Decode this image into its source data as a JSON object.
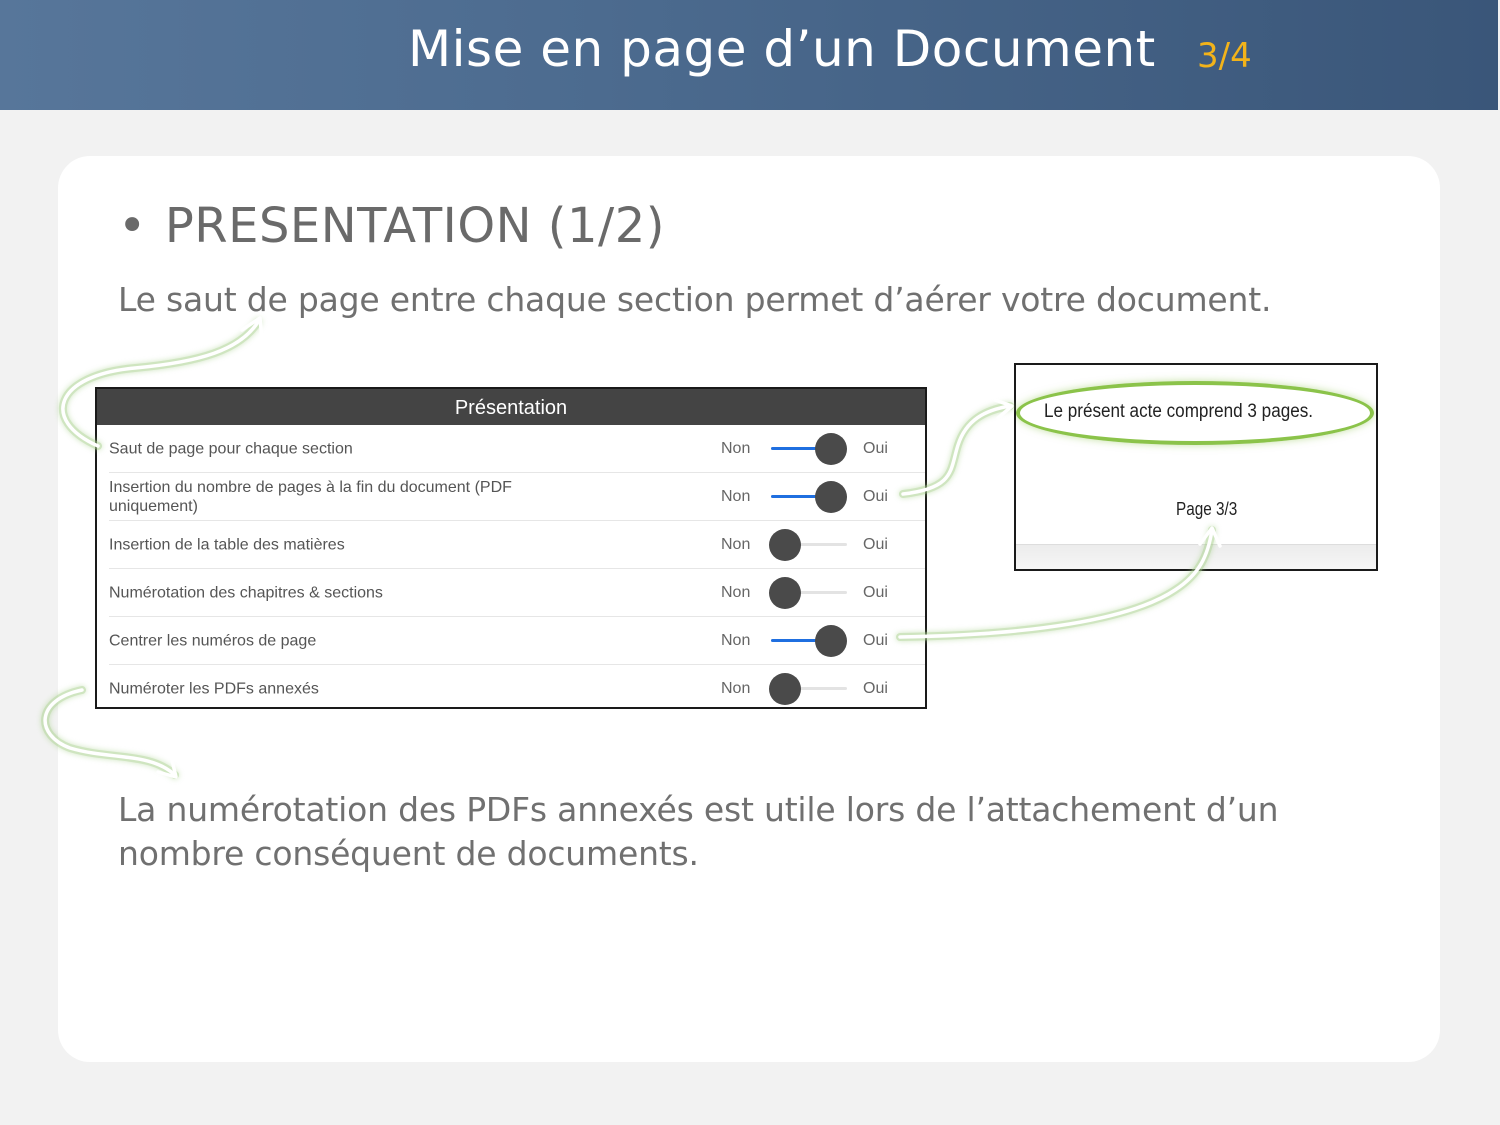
{
  "header": {
    "title": "Mise en page d’un Document",
    "page_indicator": "3/4"
  },
  "section": {
    "bullet": "•",
    "title": "PRESENTATION (1/2)",
    "lead": "Le saut de page entre chaque section permet d’aérer votre document."
  },
  "panel": {
    "title": "Présentation",
    "off_label": "Non",
    "on_label": "Oui",
    "rows": [
      {
        "label": "Saut de page pour chaque section",
        "on": true
      },
      {
        "label": "Insertion du nombre de pages à la fin du document (PDF uniquement)",
        "on": true
      },
      {
        "label": "Insertion de la table des matières",
        "on": false
      },
      {
        "label": "Numérotation des chapitres & sections",
        "on": false
      },
      {
        "label": "Centrer les numéros de page",
        "on": true
      },
      {
        "label": "Numéroter les PDFs annexés",
        "on": false
      }
    ]
  },
  "preview": {
    "line": "Le présent acte comprend 3 pages.",
    "page": "Page 3/3"
  },
  "footer": {
    "text": "La numérotation des PDFs annexés est utile lors de l’attachement d’un nombre conséquent de documents."
  },
  "colors": {
    "header_bg": "#4c6b8f",
    "page_indicator": "#f2b31a",
    "toggle_on": "#1f6fe0",
    "highlight": "#8bc34a"
  }
}
